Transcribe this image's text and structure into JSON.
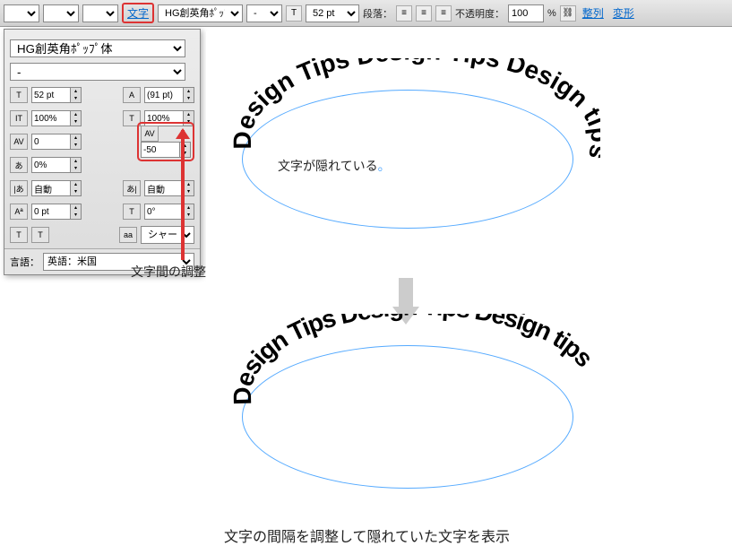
{
  "toolbar": {
    "moji_label": "文字",
    "font": "HG創英角ﾎﾟｯﾌﾟ体",
    "style": "-",
    "size": "52 pt",
    "para_label": "段落：",
    "opacity_label": "不透明度：",
    "opacity": "100",
    "align_label": "整列",
    "transform_label": "変形"
  },
  "panel": {
    "font": "HG創英角ﾎﾟｯﾌﾟ体",
    "style": "-",
    "size": "52 pt",
    "leading": "(91 pt)",
    "hscale": "100%",
    "vscale": "100%",
    "va": "0",
    "tracking": "-50",
    "tsume": "0%",
    "akil": "自動",
    "akir": "自動",
    "baseline": "0 pt",
    "rotate": "0°",
    "aa": "シャープ",
    "lang_label": "言語：",
    "lang": "英語：米国"
  },
  "annotations": {
    "adjust": "文字間の調整",
    "hidden_prefix": "文字が隠れている",
    "hidden_dot": "。",
    "bottom": "文字の間隔を調整して隠れていた文字を表示"
  },
  "ellipse": {
    "text_top": "Design Tips Design Tips Design tips",
    "text_bot": "Design Tips Design Tips Design tips"
  }
}
